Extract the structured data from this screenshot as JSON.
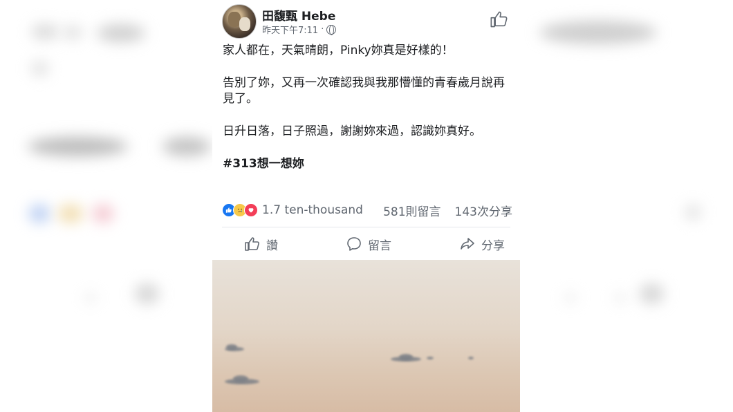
{
  "post": {
    "author_name": "田馥甄 Hebe",
    "timestamp": "昨天下午7:11",
    "separator": "·",
    "privacy_icon": "globe-icon",
    "paragraphs": [
      "家人都在，天氣晴朗，Pinky妳真是好樣的！",
      "告別了妳，又再一次確認我與我那懵懂的青春歲月說再見了。",
      "日升日落，日子照過，謝謝妳來過，認識妳真好。"
    ],
    "hashtag": "#313想一想妳"
  },
  "stats": {
    "reactions_count": "1.7 ten-thousand",
    "comments": "581則留言",
    "shares": "143次分享",
    "reaction_icons": [
      "like-reaction-icon",
      "sad-reaction-icon",
      "love-reaction-icon"
    ]
  },
  "actions": {
    "like_label": "讚",
    "comment_label": "留言",
    "share_label": "分享"
  },
  "colors": {
    "accent_blue": "#1877f2",
    "text_primary": "#1c1e21",
    "text_secondary": "#606770",
    "love_red": "#f33e58",
    "sad_yellow": "#f7c94a"
  }
}
